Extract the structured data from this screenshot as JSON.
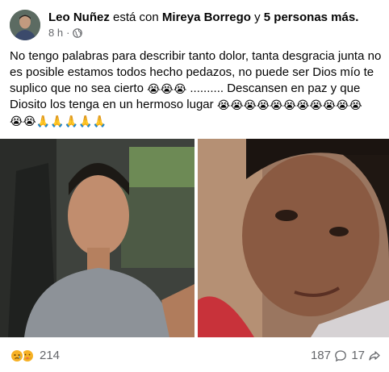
{
  "post": {
    "author": "Leo Nuñez",
    "with_text": "está con",
    "tagged": "Mireya Borrego",
    "connector": "y",
    "others": "5 personas más.",
    "time": "8 h",
    "dot": "·",
    "body_line1": "No tengo palabras para describir tanto dolor, tanta desgracia junta no",
    "body_line2": "es posible estamos todos hecho pedazos, no puede ser Dios mío te",
    "body_line3_a": "suplico que no sea cierto",
    "body_line3_b": ".......... Descansen en paz y que",
    "body_line4": "Diosito los tenga en un hermoso lugar",
    "emoji_cry": "😭",
    "emoji_pray": "🙏"
  },
  "stats": {
    "reactions": "214",
    "comments": "187",
    "shares": "17"
  },
  "colors": {
    "text": "#050505",
    "secondary": "#65676b",
    "reaction_yellow": "#f7b125"
  },
  "icons": {
    "sad_reaction": "sad-face-icon",
    "care_reaction": "care-face-icon",
    "comment": "comment-bubble-icon",
    "share": "share-arrow-icon",
    "audience": "globe-icon"
  }
}
